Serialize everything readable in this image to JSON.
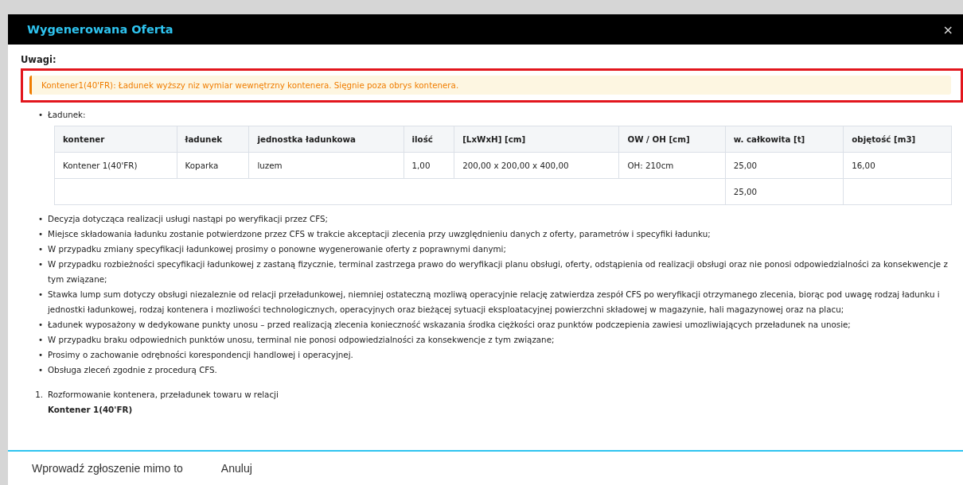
{
  "dialog": {
    "title": "Wygenerowana Oferta",
    "close": "×"
  },
  "notes_heading": "Uwagi:",
  "warning": {
    "text": "Kontener1(40'FR): Ładunek wyższy niz wymiar wewnętrzny kontenera. Sięgnie poza obrys kontenera.",
    "highlighted": true
  },
  "cargo_label": {
    "marker": "•",
    "text": "Ładunek:"
  },
  "table": {
    "columns": [
      "kontener",
      "ładunek",
      "jednostka ładunkowa",
      "ilość",
      "[LxWxH] [cm]",
      "OW / OH [cm]",
      "w. całkowita [t]",
      "objętość [m3]"
    ],
    "rows": [
      [
        "Kontener 1(40'FR)",
        "Koparka",
        "luzem",
        "1,00",
        "200,00 x 200,00 x 400,00",
        "OH: 210cm",
        "25,00",
        "16,00"
      ]
    ],
    "total": {
      "weight": "25,00"
    }
  },
  "bullets": [
    {
      "marker": "•",
      "text": "Decyzja dotycząca realizacji usługi nastąpi po weryfikacji przez CFS;"
    },
    {
      "marker": "•",
      "text": "Miejsce składowania ładunku zostanie potwierdzone przez CFS w trakcie akceptacji zlecenia przy uwzględnieniu danych z oferty, parametrów i specyfiki ładunku;"
    },
    {
      "marker": "•",
      "text": "W przypadku zmiany specyfikacji ładunkowej prosimy o ponowne wygenerowanie oferty z poprawnymi danymi;"
    },
    {
      "marker": "•",
      "text": "W przypadku rozbieżności specyfikacji ładunkowej z zastaną fizycznie, terminal zastrzega prawo do weryfikacji planu obsługi, oferty, odstąpienia od realizacji obsługi oraz nie ponosi odpowiedzialności za konsekwencje z tym związane;"
    },
    {
      "marker": "•",
      "text": "Stawka lump sum dotyczy obsługi niezaleznie od relacji przeładunkowej, niemniej ostateczną mozliwą operacyjnie relację zatwierdza zespół CFS po weryfikacji otrzymanego zlecenia, biorąc pod uwagę rodzaj ładunku i jednostki ładunkowej, rodzaj kontenera i mozliwości technologicznych, operacyjnych oraz bieżącej sytuacji eksploatacyjnej powierzchni składowej w magazynie, hali magazynowej oraz na placu;"
    },
    {
      "marker": "•",
      "text": "Ładunek wyposażony w dedykowane punkty unosu – przed realizacją zlecenia konieczność wskazania środka ciężkości oraz punktów podczepienia zawiesi umozliwiających przeładunek na unosie;"
    },
    {
      "marker": "•",
      "text": "W przypadku braku odpowiednich punktów unosu, terminal nie ponosi odpowiedzialności za konsekwencje z tym związane;"
    },
    {
      "marker": "•",
      "text": "Prosimy o zachowanie odrębności korespondencji handlowej i operacyjnej."
    },
    {
      "marker": "•",
      "text": "Obsługa zleceń zgodnie z procedurą CFS."
    }
  ],
  "steps": [
    {
      "number": "1.",
      "text": "Rozformowanie kontenera, przeładunek towaru w relacji",
      "detail": "Kontener 1(40'FR)"
    }
  ],
  "footer": {
    "buttons": [
      "Wprowadź zgłoszenie mimo to",
      "Anuluj"
    ]
  }
}
